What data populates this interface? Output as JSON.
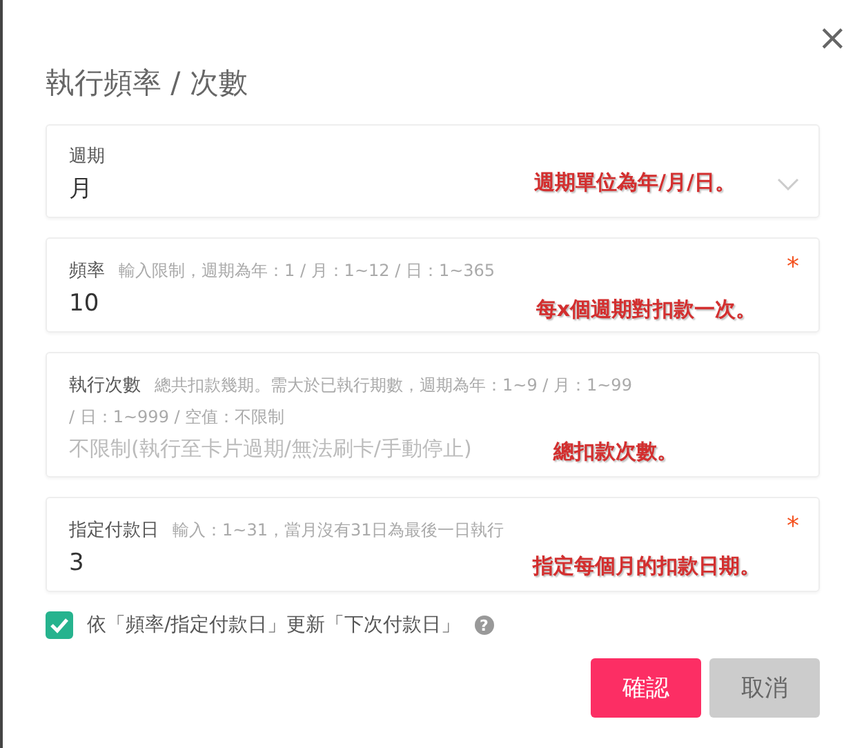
{
  "dialog": {
    "title": "執行頻率 / 次數",
    "close": "×"
  },
  "fields": [
    {
      "kind": "select",
      "label": "週期",
      "value": "月",
      "annotation": "週期單位為年/月/日。"
    },
    {
      "kind": "input",
      "label": "頻率",
      "hint": "輸入限制，週期為年：1 / 月：1~12 / 日：1~365",
      "value": "10",
      "required_mark": "*",
      "annotation": "每x個週期對扣款一次。"
    },
    {
      "kind": "input",
      "label": "執行次數",
      "hint": "總共扣款幾期。需大於已執行期數，週期為年：1~9 / 月：1~99",
      "hint_continued": "/ 日：1~999 / 空值：不限制",
      "placeholder": "不限制(執行至卡片過期/無法刷卡/手動停止)",
      "annotation": "總扣款次數。"
    },
    {
      "kind": "input",
      "label": "指定付款日",
      "hint": "輸入：1~31，當月沒有31日為最後一日執行",
      "value": "3",
      "required_mark": "*",
      "annotation": "指定每個月的扣款日期。"
    }
  ],
  "update_option": {
    "label": "依「頻率/指定付款日」更新「下次付款日」",
    "checked": true,
    "help": "?"
  },
  "buttons": [
    {
      "label": "確認",
      "kind": "primary"
    },
    {
      "label": "取消",
      "kind": "secondary"
    }
  ]
}
